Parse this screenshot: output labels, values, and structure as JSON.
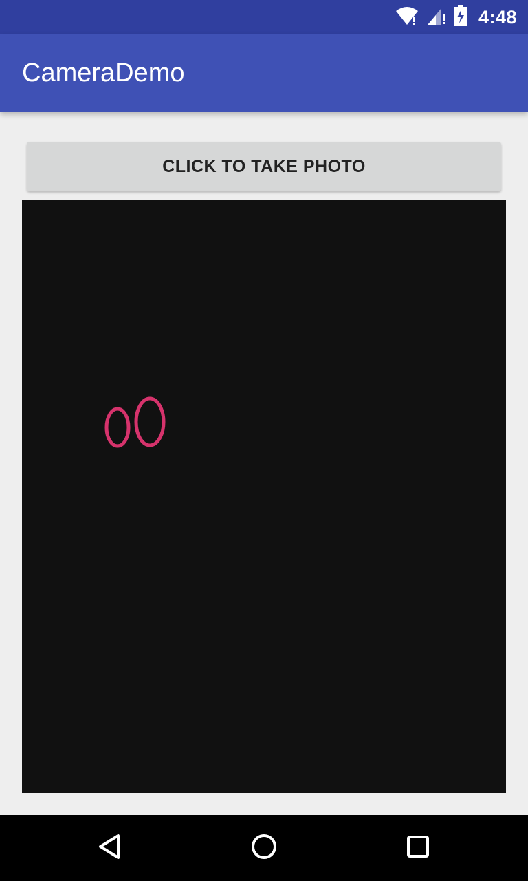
{
  "status_bar": {
    "time": "4:48",
    "icons": [
      "wifi-icon",
      "cell-signal-icon",
      "battery-charging-icon"
    ]
  },
  "app_bar": {
    "title": "CameraDemo"
  },
  "main": {
    "take_photo_label": "CLICK TO TAKE PHOTO",
    "preview_background": "#111111",
    "preview_mark_color": "#d6336c"
  },
  "nav_bar": {
    "icons": [
      "back-icon",
      "home-icon",
      "recents-icon"
    ]
  },
  "colors": {
    "status_bar": "#303f9f",
    "app_bar": "#3f51b5",
    "background": "#eeeeee",
    "button": "#d6d7d7"
  }
}
